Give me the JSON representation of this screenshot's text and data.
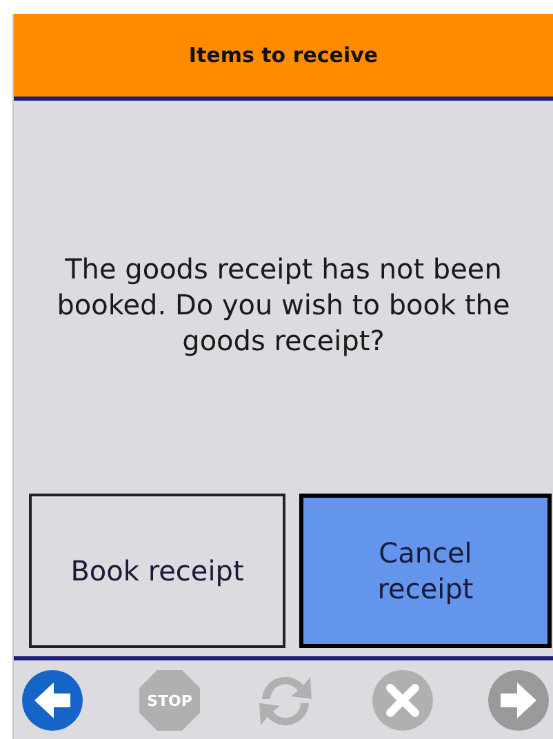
{
  "header": {
    "title": "Items to receive"
  },
  "message": "The goods receipt has not been booked. Do you wish to book the goods receipt?",
  "buttons": [
    {
      "label": "Book receipt",
      "selected": false
    },
    {
      "label": "Cancel receipt",
      "selected": true
    }
  ],
  "toolbar": [
    {
      "kind": "back",
      "disabled": false
    },
    {
      "kind": "stop",
      "label": "STOP",
      "disabled": true
    },
    {
      "kind": "refresh",
      "disabled": true
    },
    {
      "kind": "cancel",
      "disabled": true
    },
    {
      "kind": "forward",
      "disabled": true
    }
  ]
}
